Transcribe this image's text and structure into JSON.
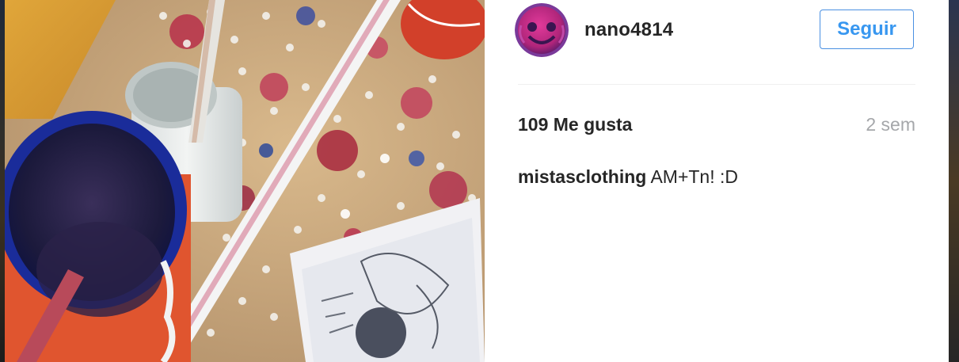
{
  "post": {
    "author": {
      "username": "nano4814",
      "follow_label": "Seguir"
    },
    "likes_text": "109 Me gusta",
    "timestamp": "2 sem",
    "caption": {
      "username": "mistasclothing",
      "text": "AM+Tn! :D"
    }
  },
  "colors": {
    "follow_blue": "#3897f0",
    "text_dark": "#262626",
    "text_muted": "#a5a7aa"
  }
}
